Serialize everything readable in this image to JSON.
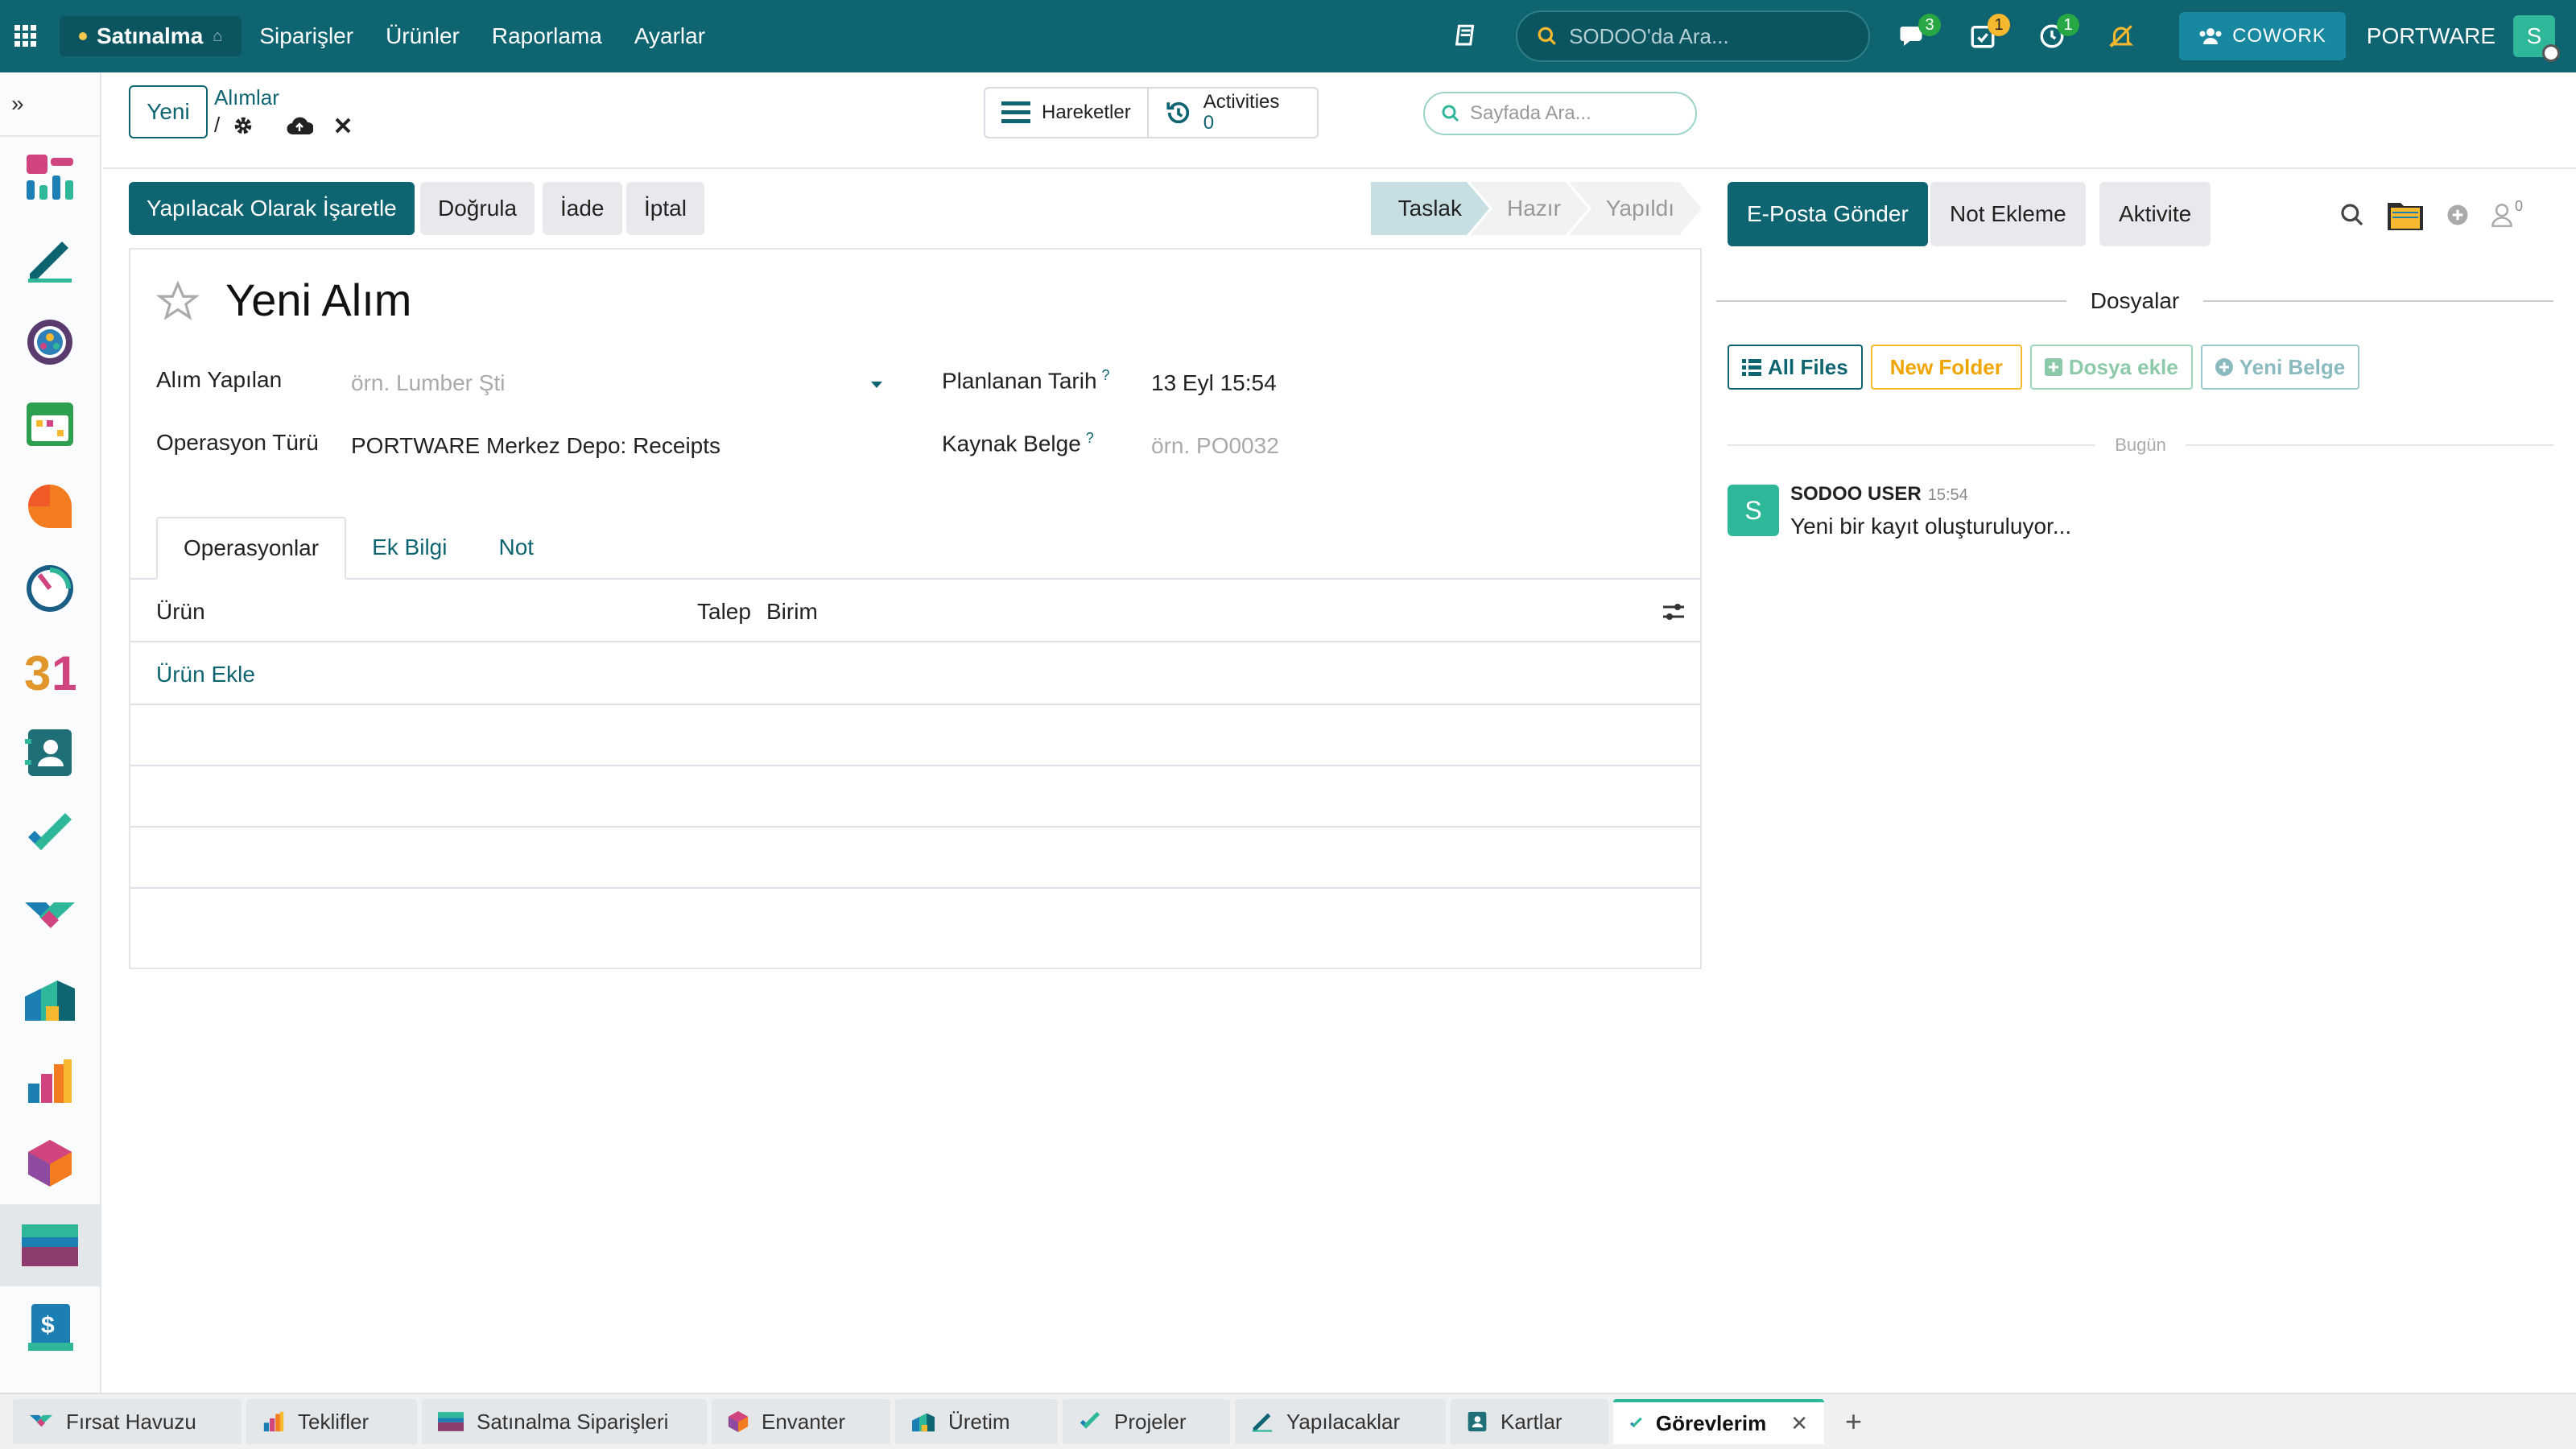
{
  "topbar": {
    "app_name": "Satınalma",
    "menu": [
      "Siparişler",
      "Ürünler",
      "Raporlama",
      "Ayarlar"
    ],
    "search_placeholder": "SODOO'da Ara...",
    "badges": {
      "messages": "3",
      "activities": "1",
      "timer": "1"
    },
    "cowork_label": "COWORK",
    "company": "PORTWARE",
    "user_initial": "S",
    "colors": {
      "navbar": "#0e6470",
      "accent": "#2fb79a"
    }
  },
  "sidebar": {
    "toggle": "»",
    "items": [
      "crm-app-icon",
      "notes-app-icon",
      "team-app-icon",
      "calendar-app-icon",
      "discuss-app-icon",
      "dashboard-app-icon",
      "calendar-31-icon",
      "contacts-app-icon",
      "project-app-icon",
      "handshake-app-icon",
      "manufacturing-app-icon",
      "sales-app-icon",
      "inventory-app-icon",
      "purchase-app-icon",
      "invoicing-app-icon"
    ],
    "active_index": 13
  },
  "control": {
    "new_button": "Yeni",
    "breadcrumb_parent": "Alımlar",
    "breadcrumb_sep": "/",
    "movements_label": "Hareketler",
    "activities_label": "Activities",
    "activities_count": "0",
    "page_search_placeholder": "Sayfada Ara..."
  },
  "status": {
    "buttons": [
      "Yapılacak Olarak İşaretle",
      "Doğrula",
      "İade",
      "İptal"
    ],
    "stages": [
      "Taslak",
      "Hazır",
      "Yapıldı"
    ],
    "current_stage": "Taslak"
  },
  "form": {
    "title": "Yeni Alım",
    "partner_label": "Alım Yapılan",
    "partner_placeholder": "örn. Lumber Şti",
    "optype_label": "Operasyon Türü",
    "optype_value": "PORTWARE Merkez Depo: Receipts",
    "date_label": "Planlanan Tarih",
    "date_value": "13 Eyl 15:54",
    "source_label": "Kaynak Belge",
    "source_placeholder": "örn. PO0032",
    "help_mark": "?",
    "tabs": [
      "Operasyonlar",
      "Ek Bilgi",
      "Not"
    ],
    "columns": {
      "product": "Ürün",
      "demand": "Talep",
      "unit": "Birim"
    },
    "add_product": "Ürün Ekle"
  },
  "chatter": {
    "send_email": "E-Posta Gönder",
    "log_note": "Not Ekleme",
    "activity": "Aktivite",
    "followers_count": "0",
    "files_title": "Dosyalar",
    "file_buttons": [
      "All Files",
      "New Folder",
      "Dosya ekle",
      "Yeni Belge"
    ],
    "today": "Bugün",
    "message": {
      "author": "SODOO USER",
      "time": "15:54",
      "body": "Yeni bir kayıt oluşturuluyor...",
      "avatar": "S"
    }
  },
  "bottom_tabs": [
    "Fırsat Havuzu",
    "Teklifler",
    "Satınalma Siparişleri",
    "Envanter",
    "Üretim",
    "Projeler",
    "Yapılacaklar",
    "Kartlar",
    "Görevlerim"
  ],
  "bottom_active": "Görevlerim",
  "bottom_close": "✕",
  "bottom_add": "+"
}
